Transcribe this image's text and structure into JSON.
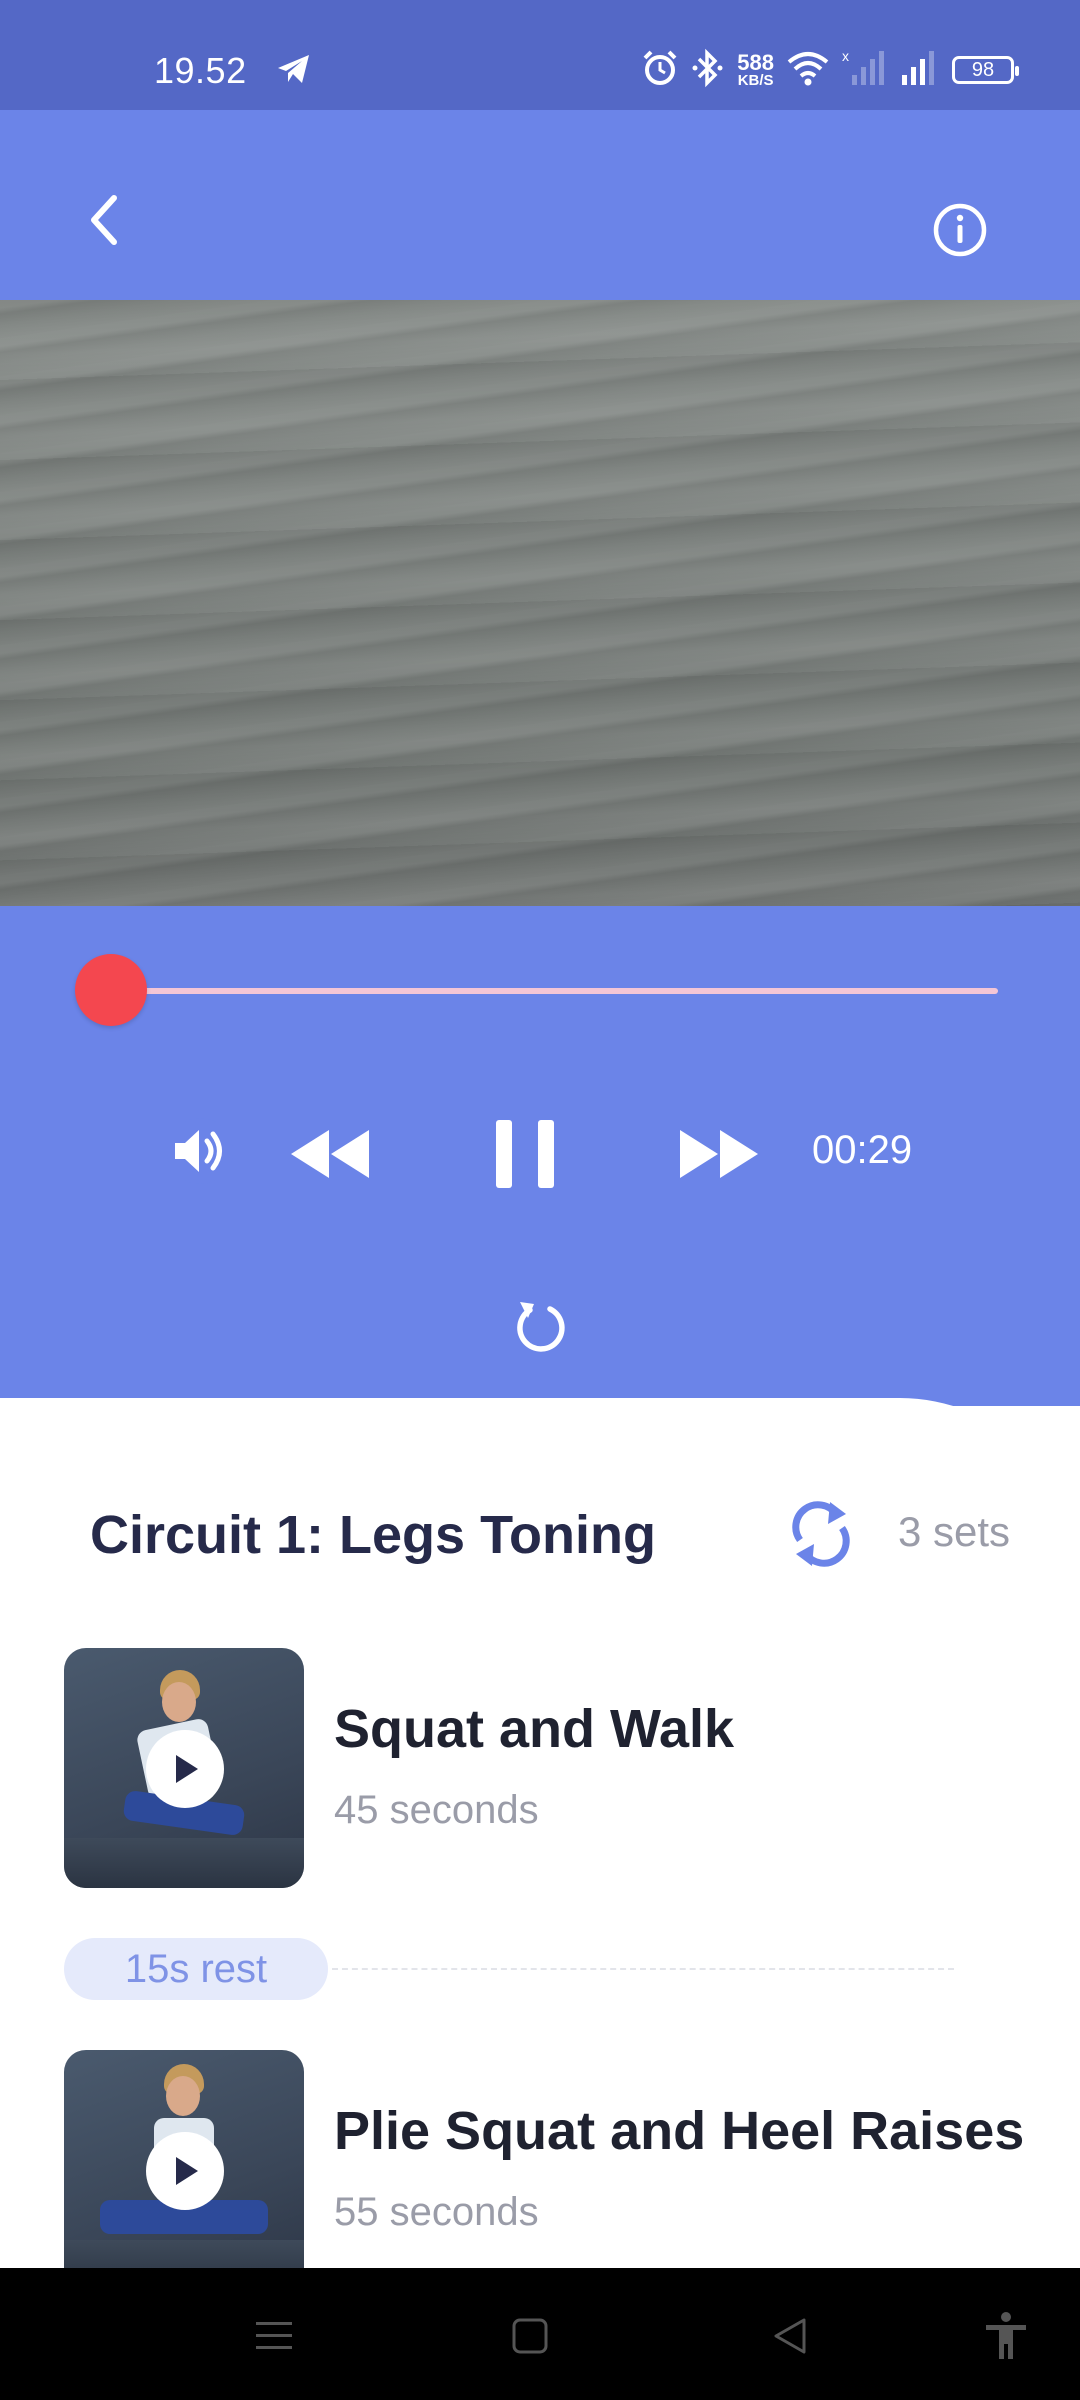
{
  "status_bar": {
    "time": "19.52",
    "network_speed_value": "588",
    "network_speed_unit": "KB/S",
    "battery": "98",
    "icons": [
      "telegram-icon",
      "alarm-icon",
      "bluetooth-icon",
      "wifi-icon",
      "signal-icon",
      "signal-icon",
      "battery-icon"
    ]
  },
  "header": {
    "back_icon": "chevron-left-icon",
    "info_icon": "info-icon"
  },
  "player": {
    "progress_fraction": 0.03,
    "remaining_time": "00:29",
    "icons": [
      "volume-icon",
      "rewind-icon",
      "pause-icon",
      "fast-forward-icon",
      "replay-icon"
    ]
  },
  "circuit": {
    "title": "Circuit 1: Legs Toning",
    "sets": "3 sets",
    "sets_icon": "repeat-icon"
  },
  "exercises": [
    {
      "name": "Squat and Walk",
      "duration": "45 seconds"
    },
    {
      "name": "Plie Squat and Heel Raises",
      "duration": "55 seconds"
    }
  ],
  "rest": {
    "label": "15s rest"
  },
  "nav_bar": {
    "icons": [
      "menu-icon",
      "home-square-icon",
      "back-triangle-icon",
      "accessibility-icon"
    ]
  },
  "colors": {
    "status_bar": "#5468c6",
    "primary": "#6b84e8",
    "seek_thumb": "#f4474f",
    "seek_track": "#f4c6d6",
    "title_text": "#262a4a",
    "muted_text": "#9a9ca8",
    "rest_pill_bg": "#e5eafb",
    "rest_pill_text": "#7f93e6"
  }
}
